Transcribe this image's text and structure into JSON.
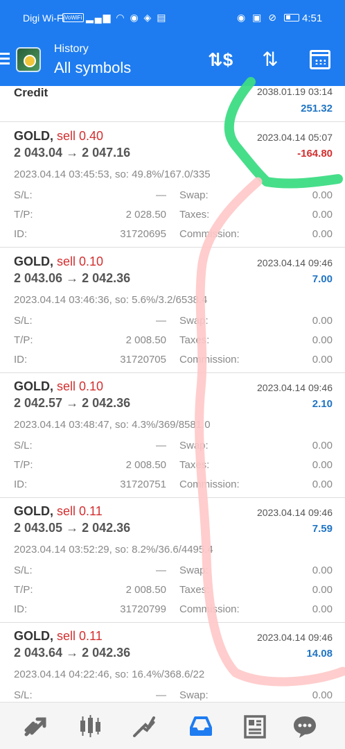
{
  "status_bar": {
    "carrier": "Digi Wi-Fi",
    "vowifi_badge": "VoWiFi",
    "time": "4:51"
  },
  "app_bar": {
    "subtitle": "History",
    "title": "All symbols",
    "icons": [
      "menu-icon",
      "app-logo",
      "balance-icon",
      "sort-icon",
      "calendar-icon"
    ]
  },
  "credit": {
    "label": "Credit",
    "date": "2038.01.19 03:14",
    "amount": "251.32"
  },
  "deals": [
    {
      "symbol": "GOLD,",
      "side": "sell 0.40",
      "prices": "2 043.04 → 2 047.16",
      "date": "2023.04.14 05:07",
      "profit": "-164.80",
      "info": "2023.04.14 03:45:53, so: 49.8%/167.0/335",
      "sl_label": "S/L:",
      "sl": "—",
      "swap_label": "Swap:",
      "swap": "0.00",
      "tp_label": "T/P:",
      "tp": "2 028.50",
      "taxes_label": "Taxes:",
      "taxes": "0.00",
      "id_label": "ID:",
      "id": "31720695",
      "commission_label": "Commission:",
      "commission": "0.00"
    },
    {
      "symbol": "GOLD,",
      "side": "sell 0.10",
      "prices": "2 043.06 → 2 042.36",
      "date": "2023.04.14 09:46",
      "profit": "7.00",
      "info": "2023.04.14 03:46:36, so: 5.6%/3.2/6538.4",
      "sl_label": "S/L:",
      "sl": "—",
      "swap_label": "Swap:",
      "swap": "0.00",
      "tp_label": "T/P:",
      "tp": "2 008.50",
      "taxes_label": "Taxes:",
      "taxes": "0.00",
      "id_label": "ID:",
      "id": "31720705",
      "commission_label": "Commission:",
      "commission": "0.00"
    },
    {
      "symbol": "GOLD,",
      "side": "sell 0.10",
      "prices": "2 042.57 → 2 042.36",
      "date": "2023.04.14 09:46",
      "profit": "2.10",
      "info": "2023.04.14 03:48:47, so: 4.3%/369/8581.0",
      "sl_label": "S/L:",
      "sl": "—",
      "swap_label": "Swap:",
      "swap": "0.00",
      "tp_label": "T/P:",
      "tp": "2 008.50",
      "taxes_label": "Taxes:",
      "taxes": "0.00",
      "id_label": "ID:",
      "id": "31720751",
      "commission_label": "Commission:",
      "commission": "0.00"
    },
    {
      "symbol": "GOLD,",
      "side": "sell 0.11",
      "prices": "2 043.05 → 2 042.36",
      "date": "2023.04.14 09:46",
      "profit": "7.59",
      "info": "2023.04.14 03:52:29, so: 8.2%/36.6/4495.4",
      "sl_label": "S/L:",
      "sl": "—",
      "swap_label": "Swap:",
      "swap": "0.00",
      "tp_label": "T/P:",
      "tp": "2 008.50",
      "taxes_label": "Taxes:",
      "taxes": "0.00",
      "id_label": "ID:",
      "id": "31720799",
      "commission_label": "Commission:",
      "commission": "0.00"
    },
    {
      "symbol": "GOLD,",
      "side": "sell 0.11",
      "prices": "2 043.64 → 2 042.36",
      "date": "2023.04.14 09:46",
      "profit": "14.08",
      "info": "2023.04.14 04:22:46, so: 16.4%/368.6/22",
      "sl_label": "S/L:",
      "sl": "—",
      "swap_label": "Swap:",
      "swap": "0.00",
      "tp_label": "T/P:",
      "tp": "",
      "taxes_label": "",
      "taxes": "",
      "id_label": "",
      "id": "",
      "commission_label": "",
      "commission": ""
    }
  ],
  "bottom_nav": [
    "quotes-icon",
    "chart-icon",
    "trade-icon",
    "history-icon",
    "news-icon",
    "chat-icon"
  ],
  "colors": {
    "primary": "#1e7cf0",
    "sell": "#d32f2f",
    "profit_positive": "#1f74c4",
    "profit_negative": "#d32f2f",
    "active_nav": "#1e7cf0",
    "annotation_green": "#3ddc84",
    "annotation_pink": "#ffc8c8"
  }
}
